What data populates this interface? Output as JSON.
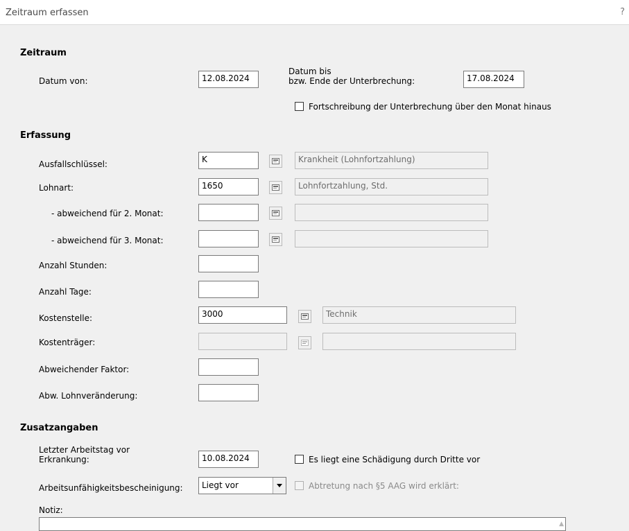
{
  "window": {
    "title": "Zeitraum erfassen",
    "help_label": "?"
  },
  "zeitraum": {
    "heading": "Zeitraum",
    "datum_von_label": "Datum von:",
    "datum_von_value": "12.08.2024",
    "datum_bis_label_1": "Datum bis",
    "datum_bis_label_2": "bzw. Ende der Unterbrechung:",
    "datum_bis_value": "17.08.2024",
    "fortschreibung_label": "Fortschreibung der Unterbrechung über den Monat hinaus",
    "fortschreibung_checked": false
  },
  "erfassung": {
    "heading": "Erfassung",
    "ausfallschluessel_label": "Ausfallschlüssel:",
    "ausfallschluessel_value": "K",
    "ausfallschluessel_desc": "Krankheit (Lohnfortzahlung)",
    "lohnart_label": "Lohnart:",
    "lohnart_value": "1650",
    "lohnart_desc": "Lohnfortzahlung, Std.",
    "monat2_label": "- abweichend für 2. Monat:",
    "monat2_value": "",
    "monat2_desc": "",
    "monat3_label": "- abweichend für 3. Monat:",
    "monat3_value": "",
    "monat3_desc": "",
    "anzahl_stunden_label": "Anzahl Stunden:",
    "anzahl_stunden_value": "",
    "anzahl_tage_label": "Anzahl Tage:",
    "anzahl_tage_value": "",
    "kostenstelle_label": "Kostenstelle:",
    "kostenstelle_value": "3000",
    "kostenstelle_desc": "Technik",
    "kostentraeger_label": "Kostenträger:",
    "kostentraeger_value": "",
    "kostentraeger_desc": "",
    "faktor_label": "Abweichender Faktor:",
    "faktor_value": "",
    "lohnveraenderung_label": "Abw. Lohnveränderung:",
    "lohnveraenderung_value": ""
  },
  "zusatz": {
    "heading": "Zusatzangaben",
    "letzter_tag_label_1": "Letzter Arbeitstag vor",
    "letzter_tag_label_2": "Erkrankung:",
    "letzter_tag_value": "10.08.2024",
    "schaedigung_label": "Es liegt eine Schädigung durch Dritte vor",
    "schaedigung_checked": false,
    "au_label": "Arbeitsunfähigkeitsbescheinigung:",
    "au_value": "Liegt vor",
    "abtretung_label": "Abtretung nach §5 AAG wird erklärt:",
    "abtretung_checked": false,
    "notiz_label": "Notiz:",
    "notiz_value": ""
  },
  "icons": {
    "lookup": "list-lookup-icon",
    "dropdown": "chevron-down-icon",
    "scroll": "scroll-up-icon"
  }
}
